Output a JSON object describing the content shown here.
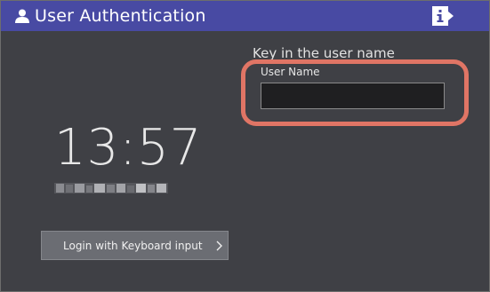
{
  "titlebar": {
    "icon": "user-icon",
    "title": "User Authentication",
    "info_icon": "info-icon"
  },
  "login_form": {
    "prompt": "Key in the user name",
    "user_name_label": "User Name",
    "user_name_value": "",
    "user_name_placeholder": ""
  },
  "clock": {
    "time": "13:57",
    "date": "(obscured)"
  },
  "keyboard_login": {
    "label": "Login with Keyboard input",
    "icon": "chevron-right-icon"
  },
  "colors": {
    "titlebar": "#484aa3",
    "background": "#3f4045",
    "highlight": "#e07565",
    "button": "#6b6d73"
  }
}
